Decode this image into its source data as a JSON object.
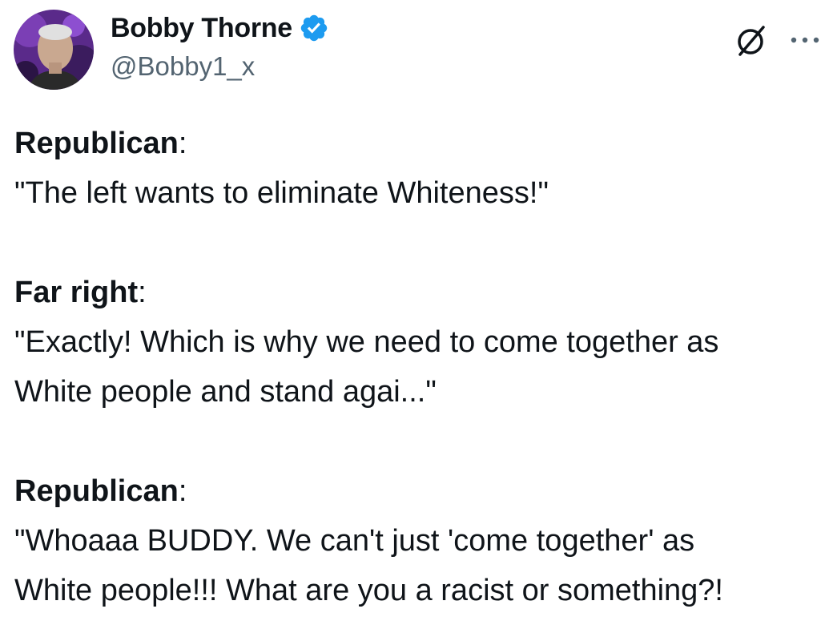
{
  "author": {
    "display_name": "Bobby Thorne",
    "handle": "@Bobby1_x",
    "verified": true,
    "verified_color": "#1d9bf0"
  },
  "actions": {
    "grok_icon": "grok-icon",
    "more_icon": "more-icon"
  },
  "post": {
    "blocks": [
      {
        "speaker": "Republican",
        "colon": ":",
        "lines": [
          "\"The left wants to eliminate Whiteness!\""
        ]
      },
      {
        "speaker": "Far right",
        "colon": ":",
        "lines": [
          "\"Exactly! Which is why we need to come together as",
          "White people and stand agai...\""
        ]
      },
      {
        "speaker": "Republican",
        "colon": ":",
        "lines": [
          "\"Whoaaa BUDDY. We can't just 'come together' as",
          "White people!!! What are you a racist or something?!"
        ]
      }
    ]
  },
  "colors": {
    "text": "#0f1419",
    "secondary": "#536471",
    "accent": "#1d9bf0",
    "avatar_bg": "#6a2c9c"
  }
}
